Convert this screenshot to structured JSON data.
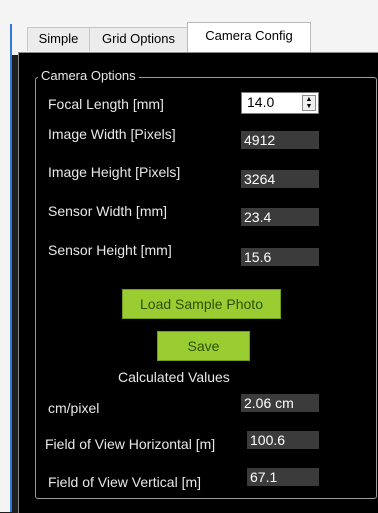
{
  "tabs": [
    {
      "label": "Simple"
    },
    {
      "label": "Grid Options"
    },
    {
      "label": "Camera Config"
    }
  ],
  "group": {
    "title": "Camera Options"
  },
  "fields": {
    "focal_length": {
      "label": "Focal Length [mm]",
      "value": "14.0"
    },
    "image_width": {
      "label": "Image Width [Pixels]",
      "value": "4912"
    },
    "image_height": {
      "label": "Image Height [Pixels]",
      "value": "3264"
    },
    "sensor_width": {
      "label": "Sensor Width [mm]",
      "value": "23.4"
    },
    "sensor_height": {
      "label": "Sensor Height [mm]",
      "value": "15.6"
    }
  },
  "buttons": {
    "load_sample": "Load Sample Photo",
    "save": "Save"
  },
  "calculated": {
    "heading": "Calculated Values",
    "cm_per_pixel": {
      "label": "cm/pixel",
      "value": "2.06 cm"
    },
    "fov_horizontal": {
      "label": "Field of View Horizontal [m]",
      "value": "100.6"
    },
    "fov_vertical": {
      "label": "Field of View Vertical [m]",
      "value": "67.1"
    }
  },
  "icons": {
    "spin_up": "▲",
    "spin_down": "▼"
  },
  "colors": {
    "button_green": "#9acd32",
    "value_bg": "#3b3b3b",
    "panel_bg": "#000000"
  }
}
